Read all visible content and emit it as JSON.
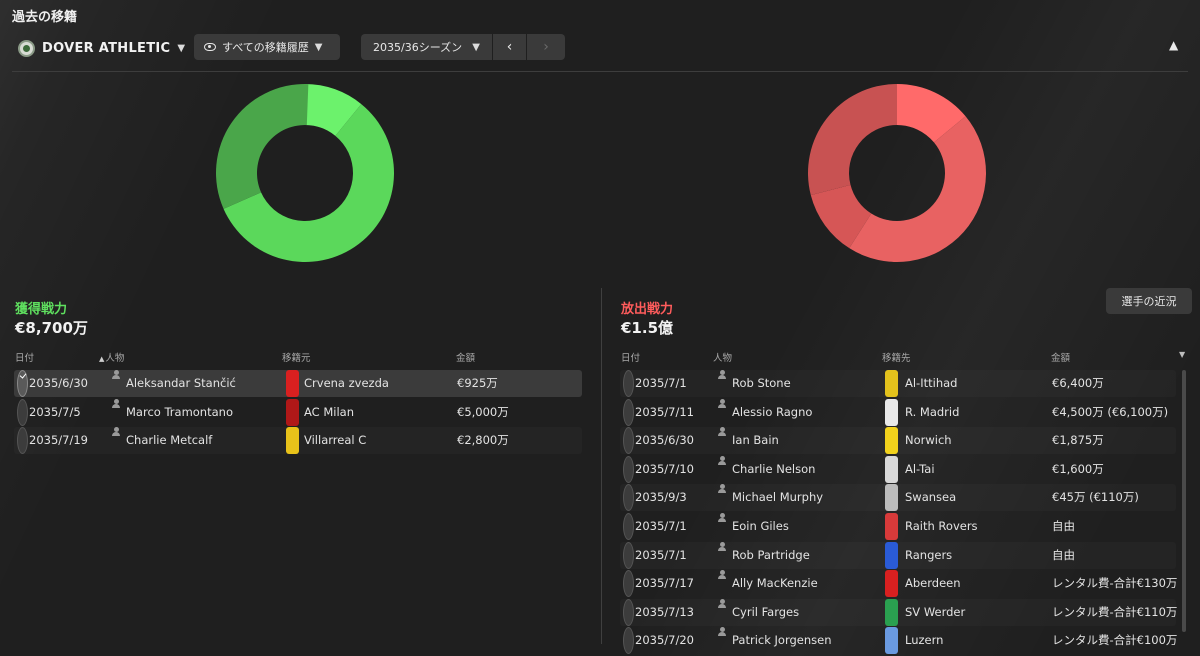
{
  "page": {
    "title": "過去の移籍"
  },
  "club": {
    "name": "DOVER ATHLETIC"
  },
  "filter": {
    "label": "すべての移籍履歴"
  },
  "season": {
    "label": "2035/36シーズン"
  },
  "incoming": {
    "label": "獲得戦力",
    "total": "€8,700万",
    "color": "#5fe05f",
    "donut_share": [
      0.109,
      0.575,
      0.322
    ],
    "donut_colors": [
      "#6cf26c",
      "#5bd85b",
      "#4aa64a"
    ],
    "headers": {
      "date": "日付",
      "person": "人物",
      "club": "移籍元",
      "fee": "金額"
    },
    "rows": [
      {
        "date": "2035/6/30",
        "person": "Aleksandar Stančić",
        "club": "Crvena zvezda",
        "fee": "€925万",
        "club_color": "#d92020",
        "selected": true
      },
      {
        "date": "2035/7/5",
        "person": "Marco Tramontano",
        "club": "AC Milan",
        "fee": "€5,000万",
        "club_color": "#b01818",
        "selected": false
      },
      {
        "date": "2035/7/19",
        "person": "Charlie Metcalf",
        "club": "Villarreal C",
        "fee": "€2,800万",
        "club_color": "#e8c21a",
        "selected": false
      }
    ]
  },
  "outgoing": {
    "label": "放出戦力",
    "total": "€1.5億",
    "color": "#ff5c5c",
    "news_button": "選手の近況",
    "donut_share": [
      0.14,
      0.45,
      0.12,
      0.29
    ],
    "donut_colors": [
      "#ff6a6a",
      "#e86262",
      "#d65656",
      "#c85252"
    ],
    "headers": {
      "date": "日付",
      "person": "人物",
      "club": "移籍先",
      "fee": "金額"
    },
    "rows": [
      {
        "date": "2035/7/1",
        "person": "Rob Stone",
        "club": "Al-Ittihad",
        "fee": "€6,400万",
        "club_color": "#e3c21c"
      },
      {
        "date": "2035/7/11",
        "person": "Alessio Ragno",
        "club": "R. Madrid",
        "fee": "€4,500万 (€6,100万)",
        "club_color": "#e8e8e8"
      },
      {
        "date": "2035/6/30",
        "person": "Ian Bain",
        "club": "Norwich",
        "fee": "€1,875万",
        "club_color": "#f2d21c"
      },
      {
        "date": "2035/7/10",
        "person": "Charlie Nelson",
        "club": "Al-Tai",
        "fee": "€1,600万",
        "club_color": "#d8d8d8"
      },
      {
        "date": "2035/9/3",
        "person": "Michael Murphy",
        "club": "Swansea",
        "fee": "€45万 (€110万)",
        "club_color": "#bcbcbc"
      },
      {
        "date": "2035/7/1",
        "person": "Eoin Giles",
        "club": "Raith Rovers",
        "fee": "自由",
        "club_color": "#d83a3a"
      },
      {
        "date": "2035/7/1",
        "person": "Rob Partridge",
        "club": "Rangers",
        "fee": "自由",
        "club_color": "#2a5bd6"
      },
      {
        "date": "2035/7/17",
        "person": "Ally MacKenzie",
        "club": "Aberdeen",
        "fee": "レンタル費-合計€130万",
        "club_color": "#d82020"
      },
      {
        "date": "2035/7/13",
        "person": "Cyril Farges",
        "club": "SV Werder",
        "fee": "レンタル費-合計€110万",
        "club_color": "#2aa050"
      },
      {
        "date": "2035/7/20",
        "person": "Patrick Jorgensen",
        "club": "Luzern",
        "fee": "レンタル費-合計€100万",
        "club_color": "#6a9ae0"
      }
    ]
  }
}
